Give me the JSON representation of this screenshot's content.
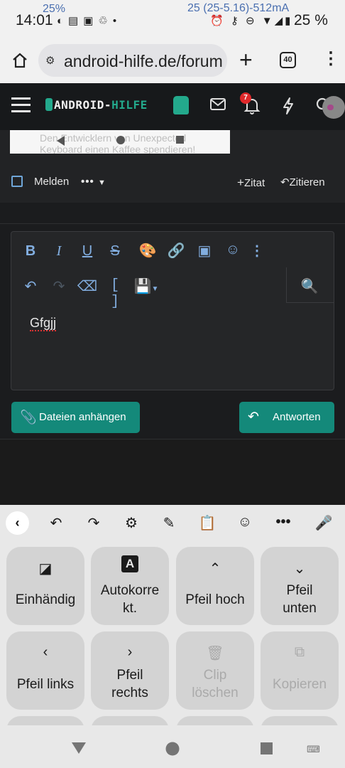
{
  "status_bar": {
    "time": "14:01",
    "overlay_percent": "25%",
    "overlay_current": "25 (25-5.16)-512mA",
    "battery_percent": "25 %"
  },
  "browser": {
    "url": "android-hilfe.de/forum",
    "tab_count": "40"
  },
  "forum_header": {
    "logo_part1": "ANDROID-",
    "logo_part2": "HILFE",
    "notification_count": "7"
  },
  "post": {
    "preview_text_line1": "Den Entwicklern von Unexpected",
    "preview_text_line2": "Keyboard einen Kaffee spendieren!",
    "report_label": "Melden",
    "more_label": "•••",
    "quote_label": "Zitat",
    "reply_quote_label": "Zitieren"
  },
  "editor": {
    "content": "Gfgjj",
    "attach_label": "Dateien anhängen",
    "reply_label": "Antworten"
  },
  "keyboard": {
    "keys": [
      {
        "icon": "one-hand-icon",
        "label": "Einhändig",
        "enabled": true
      },
      {
        "icon": "autocorrect-icon",
        "label": "Autokorre kt.",
        "enabled": true
      },
      {
        "icon": "arrow-up-icon",
        "label": "Pfeil hoch",
        "enabled": true
      },
      {
        "icon": "arrow-down-icon",
        "label": "Pfeil unten",
        "enabled": true
      },
      {
        "icon": "arrow-left-icon",
        "label": "Pfeil links",
        "enabled": true
      },
      {
        "icon": "arrow-right-icon",
        "label": "Pfeil rechts",
        "enabled": true
      },
      {
        "icon": "clip-delete-icon",
        "label": "Clip löschen",
        "enabled": false
      },
      {
        "icon": "copy-icon",
        "label": "Kopieren",
        "enabled": false
      }
    ]
  },
  "colors": {
    "accent": "#14897a",
    "link_blue": "#82aee0",
    "badge_red": "#e0282a"
  }
}
